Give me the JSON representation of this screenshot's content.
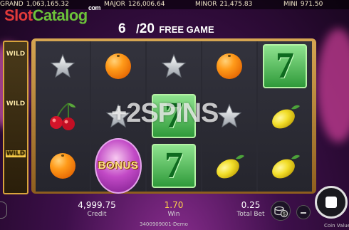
{
  "jackpots": [
    {
      "label": "GRAND",
      "value": "1,063,165.32"
    },
    {
      "label": "MAJOR",
      "value": "126,006.64"
    },
    {
      "label": "MINOR",
      "value": "21,475.83"
    },
    {
      "label": "MINI",
      "value": "971.50"
    }
  ],
  "logo": {
    "part1": "Slot",
    "part2": "Catalog",
    "suffix": "com"
  },
  "free_game": {
    "current": "6",
    "separator": "/",
    "total": "20",
    "label": "FREE GAME"
  },
  "side_wilds": [
    "WILD",
    "WILD",
    "WILD"
  ],
  "reels": [
    [
      "star",
      "cherry",
      "orange"
    ],
    [
      "orange",
      "star",
      "bonus"
    ],
    [
      "star",
      "seven",
      "seven"
    ],
    [
      "orange",
      "star",
      "lemon"
    ],
    [
      "seven",
      "lemon",
      "lemon"
    ]
  ],
  "bonus_label": "BONUS",
  "seven_glyph": "7",
  "overlay_text": "+2SPINS",
  "stats": {
    "credit": {
      "value": "4,999.75",
      "label": "Credit"
    },
    "win": {
      "value": "1.70",
      "label": "Win"
    },
    "bet": {
      "value": "0.25",
      "label": "Total Bet"
    }
  },
  "footer": {
    "id": "3400909001-Demo",
    "coin_value": "Coin Value"
  },
  "colors": {
    "frame": "#d6a652",
    "seven_bg": "#2f9a3a",
    "win_value": "#ffd24a"
  }
}
